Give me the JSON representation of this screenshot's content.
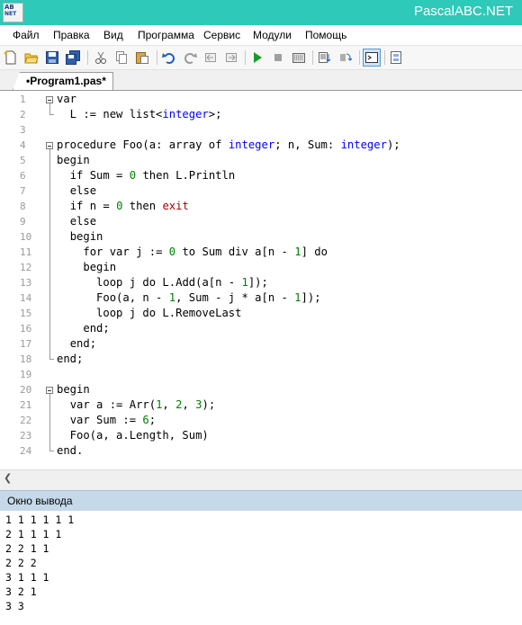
{
  "window": {
    "title": "PascalABC.NET",
    "logo_text_1": "AB",
    "logo_text_2": "NET"
  },
  "menu": [
    "Файл",
    "Правка",
    "Вид",
    "Программа",
    "Сервис",
    "Модули",
    "Помощь"
  ],
  "toolbar": {
    "buttons": [
      "new-file-icon",
      "open-folder-icon",
      "save-icon",
      "save-all-icon",
      "cut-icon",
      "copy-icon",
      "paste-icon",
      "undo-icon",
      "redo-icon",
      "navigate-back-icon",
      "navigate-forward-icon",
      "run-icon",
      "stop-icon",
      "compile-icon",
      "debug-step-into-icon",
      "debug-step-over-icon",
      "output-window-icon",
      "form-designer-icon"
    ]
  },
  "editor": {
    "tab_label": "•Program1.pas*",
    "line_numbers": [
      "1",
      "2",
      "3",
      "4",
      "5",
      "6",
      "7",
      "8",
      "9",
      "10",
      "11",
      "12",
      "13",
      "14",
      "15",
      "16",
      "17",
      "18",
      "19",
      "20",
      "21",
      "22",
      "23",
      "24"
    ],
    "lines": [
      [
        [
          "kw",
          "var"
        ]
      ],
      [
        [
          "t",
          "  L := new list<"
        ],
        [
          "ty",
          "integer"
        ],
        [
          "t",
          ">;"
        ]
      ],
      [
        [
          "t",
          ""
        ]
      ],
      [
        [
          "kw",
          "procedure"
        ],
        [
          "t",
          " Foo(a: "
        ],
        [
          "kw",
          "array"
        ],
        [
          "t",
          " "
        ],
        [
          "kw",
          "of"
        ],
        [
          "t",
          " "
        ],
        [
          "ty",
          "integer"
        ],
        [
          "t",
          "; n, Sum: "
        ],
        [
          "ty",
          "integer"
        ],
        [
          "t",
          ");"
        ]
      ],
      [
        [
          "kw",
          "begin"
        ]
      ],
      [
        [
          "t",
          "  "
        ],
        [
          "kw",
          "if"
        ],
        [
          "t",
          " Sum = "
        ],
        [
          "num",
          "0"
        ],
        [
          "t",
          " "
        ],
        [
          "kw",
          "then"
        ],
        [
          "t",
          " L.Println"
        ]
      ],
      [
        [
          "t",
          "  "
        ],
        [
          "kw",
          "else"
        ]
      ],
      [
        [
          "t",
          "  "
        ],
        [
          "kw",
          "if"
        ],
        [
          "t",
          " n = "
        ],
        [
          "num",
          "0"
        ],
        [
          "t",
          " "
        ],
        [
          "kw",
          "then"
        ],
        [
          "t",
          " "
        ],
        [
          "ex",
          "exit"
        ]
      ],
      [
        [
          "t",
          "  "
        ],
        [
          "kw",
          "else"
        ]
      ],
      [
        [
          "t",
          "  "
        ],
        [
          "kw",
          "begin"
        ]
      ],
      [
        [
          "t",
          "    "
        ],
        [
          "kw",
          "for"
        ],
        [
          "t",
          " "
        ],
        [
          "kw",
          "var"
        ],
        [
          "t",
          " j := "
        ],
        [
          "num",
          "0"
        ],
        [
          "t",
          " "
        ],
        [
          "kw",
          "to"
        ],
        [
          "t",
          " Sum "
        ],
        [
          "kw",
          "div"
        ],
        [
          "t",
          " a[n - "
        ],
        [
          "num",
          "1"
        ],
        [
          "t",
          "] "
        ],
        [
          "kw",
          "do"
        ]
      ],
      [
        [
          "t",
          "    "
        ],
        [
          "kw",
          "begin"
        ]
      ],
      [
        [
          "t",
          "      "
        ],
        [
          "kw",
          "loop"
        ],
        [
          "t",
          " j "
        ],
        [
          "kw",
          "do"
        ],
        [
          "t",
          " L.Add(a[n - "
        ],
        [
          "num",
          "1"
        ],
        [
          "t",
          "]);"
        ]
      ],
      [
        [
          "t",
          "      Foo(a, n - "
        ],
        [
          "num",
          "1"
        ],
        [
          "t",
          ", Sum - j * a[n - "
        ],
        [
          "num",
          "1"
        ],
        [
          "t",
          "]);"
        ]
      ],
      [
        [
          "t",
          "      "
        ],
        [
          "kw",
          "loop"
        ],
        [
          "t",
          " j "
        ],
        [
          "kw",
          "do"
        ],
        [
          "t",
          " L.RemoveLast"
        ]
      ],
      [
        [
          "t",
          "    "
        ],
        [
          "kw",
          "end"
        ],
        [
          "t",
          ";"
        ]
      ],
      [
        [
          "t",
          "  "
        ],
        [
          "kw",
          "end"
        ],
        [
          "t",
          ";"
        ]
      ],
      [
        [
          "kw",
          "end"
        ],
        [
          "t",
          ";"
        ]
      ],
      [
        [
          "t",
          ""
        ]
      ],
      [
        [
          "kw",
          "begin"
        ]
      ],
      [
        [
          "t",
          "  "
        ],
        [
          "kw",
          "var"
        ],
        [
          "t",
          " a := Arr("
        ],
        [
          "num",
          "1"
        ],
        [
          "t",
          ", "
        ],
        [
          "num",
          "2"
        ],
        [
          "t",
          ", "
        ],
        [
          "num",
          "3"
        ],
        [
          "t",
          ");"
        ]
      ],
      [
        [
          "t",
          "  "
        ],
        [
          "kw",
          "var"
        ],
        [
          "t",
          " Sum := "
        ],
        [
          "num",
          "6"
        ],
        [
          "t",
          ";"
        ]
      ],
      [
        [
          "t",
          "  Foo(a, a.Length, Sum)"
        ]
      ],
      [
        [
          "kw",
          "end"
        ],
        [
          "t",
          "."
        ]
      ]
    ]
  },
  "output": {
    "title": "Окно вывода",
    "lines": [
      "1 1 1 1 1 1",
      "2 1 1 1 1",
      "2 2 1 1",
      "2 2 2",
      "3 1 1 1",
      "3 2 1",
      "3 3"
    ]
  },
  "colors": {
    "keyword": "#000000",
    "type": "#0000ff",
    "number": "#008000",
    "exit": "#b00000",
    "titlebar": "#2ec9b8",
    "output_header": "#c6d9ea"
  }
}
